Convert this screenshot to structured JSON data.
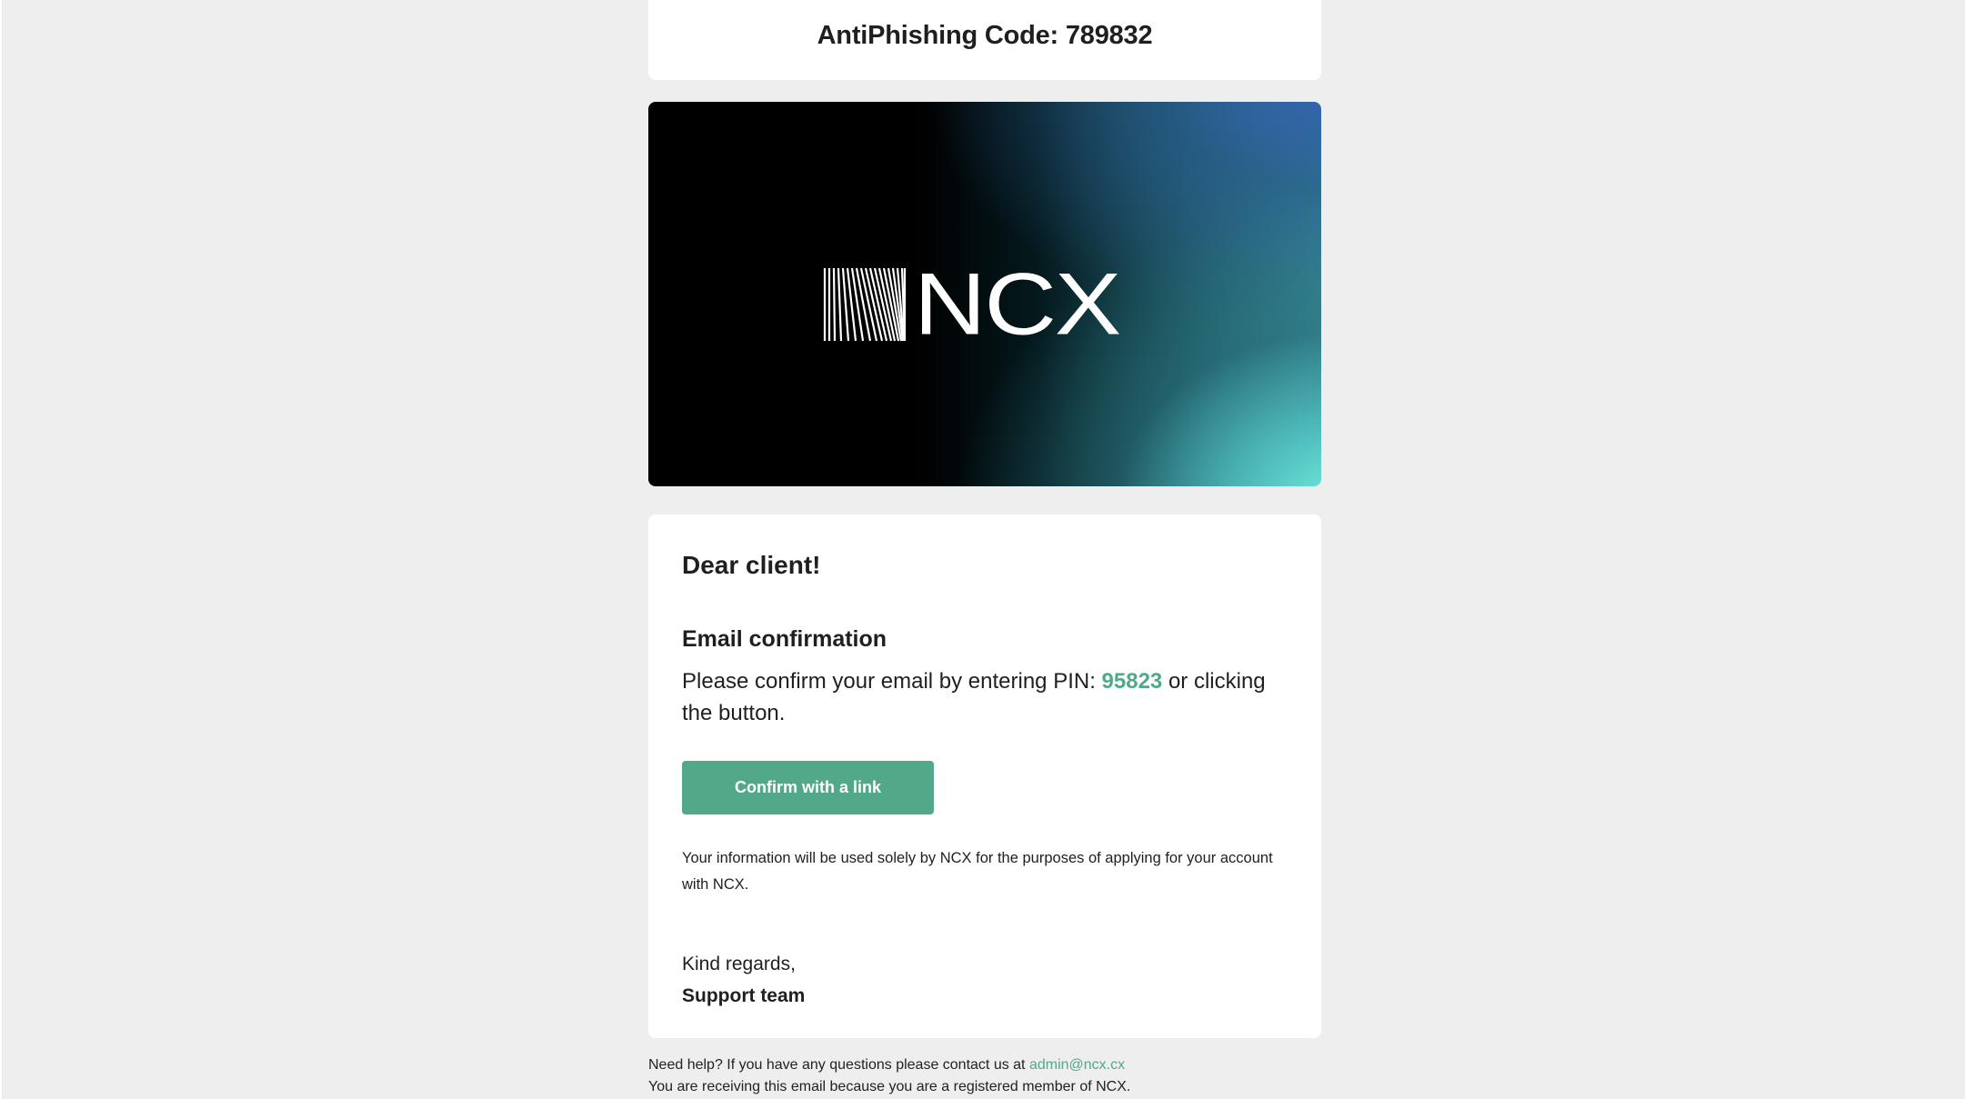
{
  "header": {
    "antiphishing_code": "AntiPhishing Code: 789832"
  },
  "banner": {
    "logo_text": "NCX",
    "logo_icon": "ncx-lines-logo-icon"
  },
  "content": {
    "greeting": "Dear client!",
    "section_title": "Email confirmation",
    "confirm_text_before": "Please confirm your email by entering PIN: ",
    "pin": "95823",
    "confirm_text_after": " or clicking the button.",
    "button_label": "Confirm with a link",
    "info_text": "Your information will be used solely by NCX for the purposes of applying for your account with NCX.",
    "regards": "Kind regards,",
    "signature": "Support team"
  },
  "footer": {
    "help_text": "Need help? If you have any questions please contact us at ",
    "email": "admin@ncx.cx",
    "notice": "You are receiving this email because you are a registered member of NCX."
  },
  "colors": {
    "accent": "#52a98a",
    "background": "#eeeeee",
    "card": "#ffffff"
  }
}
